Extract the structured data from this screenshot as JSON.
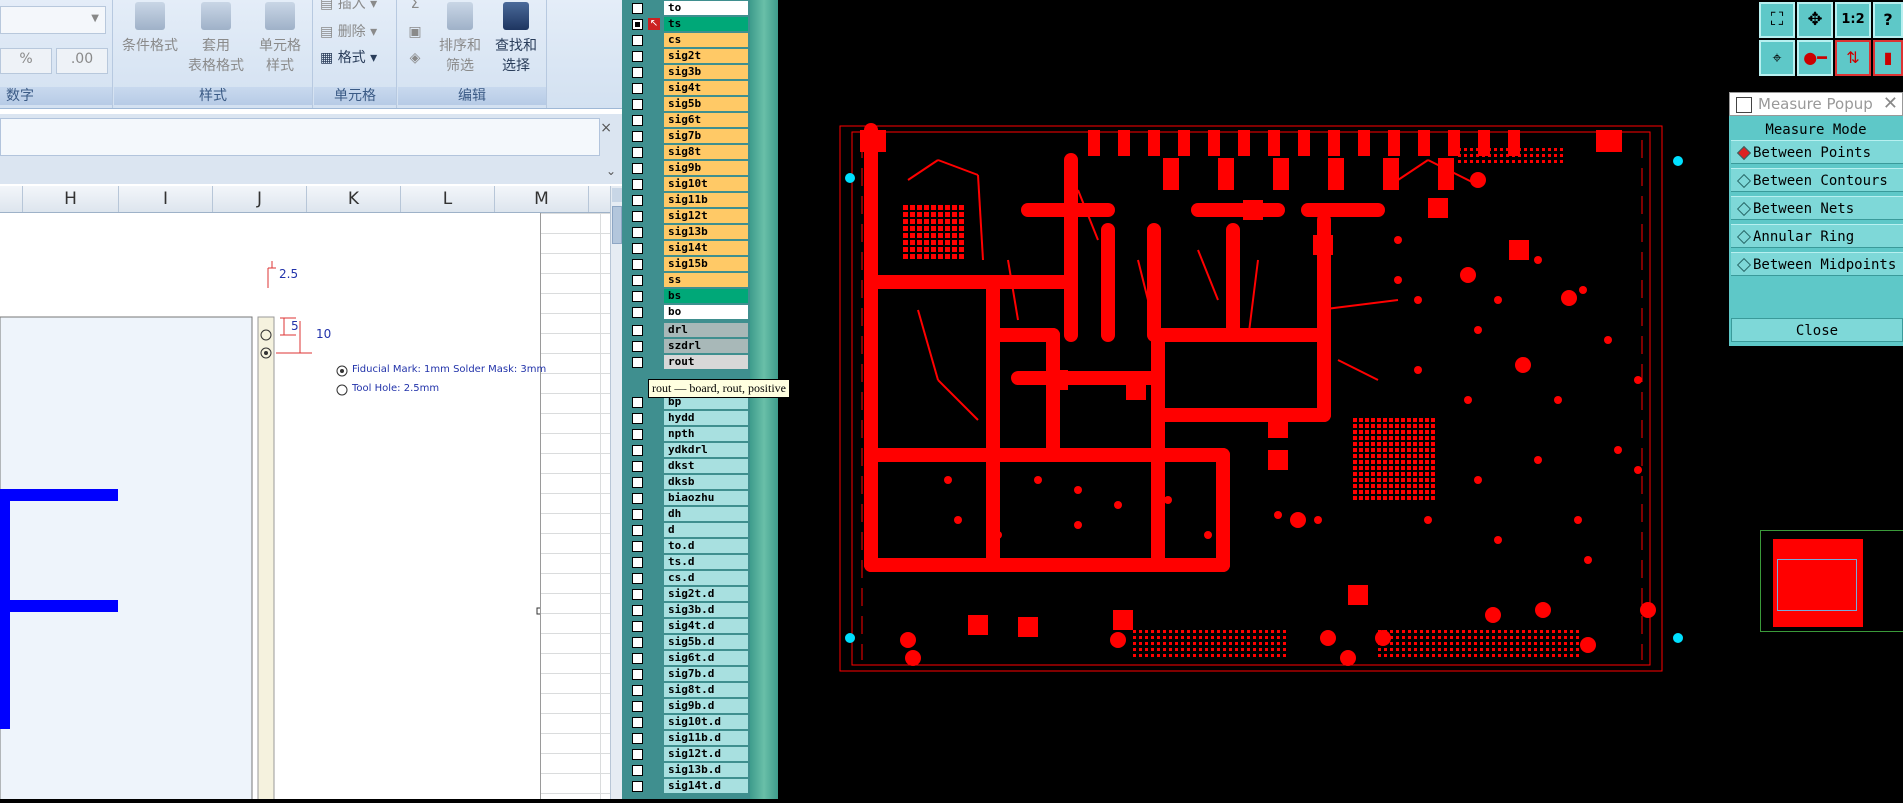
{
  "excel": {
    "ribbon": {
      "number_group_label": "数字",
      "percent": "%",
      "decimal": ".00",
      "styles": {
        "label": "样式",
        "conditional": "条件格式",
        "table_format_1": "套用",
        "table_format_2": "表格格式",
        "cell_style_1": "单元格",
        "cell_style_2": "样式"
      },
      "cells": {
        "label": "单元格",
        "insert": "插入",
        "delete": "删除",
        "format": "格式"
      },
      "editing": {
        "label": "编辑",
        "sigma": "Σ",
        "sort_1": "排序和",
        "sort_2": "筛选",
        "find_1": "查找和",
        "find_2": "选择"
      }
    },
    "formula_close": "×",
    "columns": [
      "H",
      "I",
      "J",
      "K",
      "L",
      "M"
    ],
    "drawing": {
      "dim_top": "2.5",
      "dim_mid": "5",
      "dim_right": "10",
      "legend_fiducial": "Fiducial Mark: 1mm  Solder Mask: 3mm",
      "legend_tool": "Tool Hole: 2.5mm",
      "big_letter": "F"
    }
  },
  "layers": {
    "board": [
      {
        "name": "to",
        "color": "#ffffff"
      },
      {
        "name": "ts",
        "color": "#00a878"
      },
      {
        "name": "cs",
        "color": "#ffc966"
      },
      {
        "name": "sig2t",
        "color": "#ffc966"
      },
      {
        "name": "sig3b",
        "color": "#ffc966"
      },
      {
        "name": "sig4t",
        "color": "#ffc966"
      },
      {
        "name": "sig5b",
        "color": "#ffc966"
      },
      {
        "name": "sig6t",
        "color": "#ffc966"
      },
      {
        "name": "sig7b",
        "color": "#ffc966"
      },
      {
        "name": "sig8t",
        "color": "#ffc966"
      },
      {
        "name": "sig9b",
        "color": "#ffc966"
      },
      {
        "name": "sig10t",
        "color": "#ffc966"
      },
      {
        "name": "sig11b",
        "color": "#ffc966"
      },
      {
        "name": "sig12t",
        "color": "#ffc966"
      },
      {
        "name": "sig13b",
        "color": "#ffc966"
      },
      {
        "name": "sig14t",
        "color": "#ffc966"
      },
      {
        "name": "sig15b",
        "color": "#ffc966"
      },
      {
        "name": "ss",
        "color": "#ffc966"
      },
      {
        "name": "bs",
        "color": "#00a878"
      },
      {
        "name": "bo",
        "color": "#ffffff"
      }
    ],
    "drill": [
      {
        "name": "drl",
        "color": "#a8b8b8"
      },
      {
        "name": "szdrl",
        "color": "#a8b8b8"
      },
      {
        "name": "rout",
        "color": "#d8d8d8"
      }
    ],
    "misc": [
      {
        "name": "bp",
        "color": "#a8e0e0"
      },
      {
        "name": "hydd",
        "color": "#a8e0e0"
      },
      {
        "name": "npth",
        "color": "#a8e0e0"
      },
      {
        "name": "ydkdrl",
        "color": "#a8e0e0"
      },
      {
        "name": "dkst",
        "color": "#a8e0e0"
      },
      {
        "name": "dksb",
        "color": "#a8e0e0"
      },
      {
        "name": "biaozhu",
        "color": "#a8e0e0"
      },
      {
        "name": "dh",
        "color": "#a8e0e0"
      },
      {
        "name": "d",
        "color": "#a8e0e0"
      },
      {
        "name": "to.d",
        "color": "#a8e0e0"
      },
      {
        "name": "ts.d",
        "color": "#a8e0e0"
      },
      {
        "name": "cs.d",
        "color": "#a8e0e0"
      },
      {
        "name": "sig2t.d",
        "color": "#a8e0e0"
      },
      {
        "name": "sig3b.d",
        "color": "#a8e0e0"
      },
      {
        "name": "sig4t.d",
        "color": "#a8e0e0"
      },
      {
        "name": "sig5b.d",
        "color": "#a8e0e0"
      },
      {
        "name": "sig6t.d",
        "color": "#a8e0e0"
      },
      {
        "name": "sig7b.d",
        "color": "#a8e0e0"
      },
      {
        "name": "sig8t.d",
        "color": "#a8e0e0"
      },
      {
        "name": "sig9b.d",
        "color": "#a8e0e0"
      },
      {
        "name": "sig10t.d",
        "color": "#a8e0e0"
      },
      {
        "name": "sig11b.d",
        "color": "#a8e0e0"
      },
      {
        "name": "sig12t.d",
        "color": "#a8e0e0"
      },
      {
        "name": "sig13b.d",
        "color": "#a8e0e0"
      },
      {
        "name": "sig14t.d",
        "color": "#a8e0e0"
      }
    ],
    "tooltip": "rout — board, rout, positive"
  },
  "measure_popup": {
    "title": "Measure Popup",
    "mode_header": "Measure Mode",
    "options": [
      "Between Points",
      "Between Contours",
      "Between Nets",
      "Annular Ring",
      "Between Midpoints"
    ],
    "selected": "Between Points",
    "close_label": "Close"
  },
  "toolbar": {
    "zoom_ratio": "1:2",
    "help": "?"
  },
  "colors": {
    "pcb_copper": "#ff0000",
    "pcb_background": "#000000",
    "fiducial": "#00e0ff",
    "layer_panel": "#3f8f8f"
  }
}
